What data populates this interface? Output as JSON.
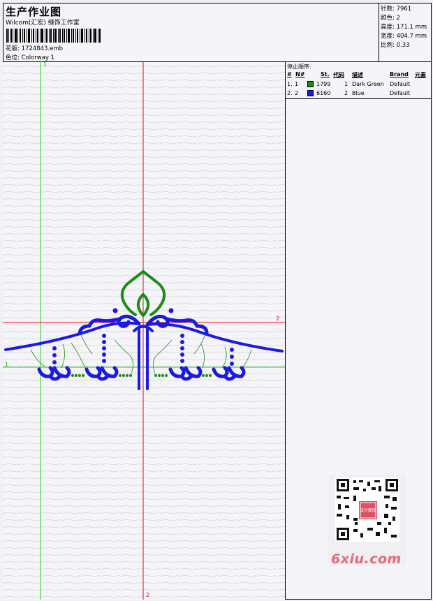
{
  "header": {
    "title": "生产作业图",
    "subtitle": "Wilcom(汇宏) 缝饰工作室",
    "design_label": "花版:",
    "design_value": "1724843.emb",
    "colorway_label": "色位:",
    "colorway_value": "Colorway 1"
  },
  "specs": {
    "stitches_label": "针数:",
    "stitches_value": "7961",
    "colors_label": "颜色:",
    "colors_value": "2",
    "height_label": "高度:",
    "height_value": "171.1 mm",
    "width_label": "宽度:",
    "width_value": "404.7 mm",
    "scale_label": "比例:",
    "scale_value": "0.33"
  },
  "stop_sequence": {
    "caption": "停止顺序:",
    "headers": [
      "#",
      "N#",
      "St.",
      "代码",
      "描述",
      "Brand",
      "元素"
    ],
    "rows": [
      {
        "num": "1.",
        "n": "1",
        "color": "#1a8c1a",
        "st": "1799",
        "code": "1",
        "desc": "Dark Green",
        "brand": "Default"
      },
      {
        "num": "2.",
        "n": "2",
        "color": "#1a1ae6",
        "st": "6160",
        "code": "2",
        "desc": "Blue",
        "brand": "Default"
      }
    ]
  },
  "guides": {
    "v1_label": "1",
    "v2_label": "2",
    "h1_label": "1",
    "h2_label": "2"
  },
  "colors": {
    "green_thread": "#1a8c1a",
    "blue_thread": "#1a1ae6",
    "guide_green": "#22cc22",
    "guide_red": "#dd1111"
  },
  "watermark": {
    "text": "6xiu.com",
    "stamp": "设计图库"
  }
}
